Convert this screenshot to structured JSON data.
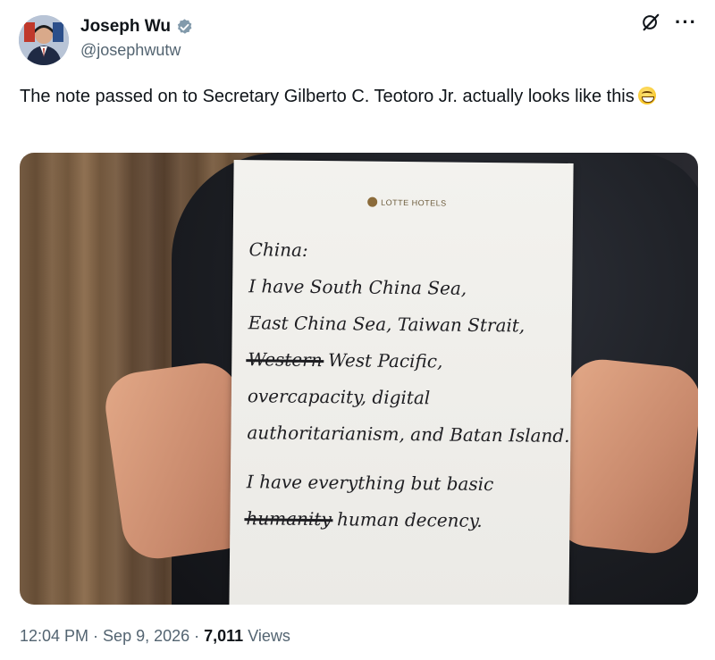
{
  "author": {
    "display_name": "Joseph Wu",
    "handle": "@josephwutw"
  },
  "tweet": {
    "text": "The note passed on to Secretary Gilberto C. Teotoro Jr. actually looks like this",
    "emoji_icon": "grinning-face-icon"
  },
  "media": {
    "brand": "LOTTE HOTELS",
    "note_lines": [
      {
        "before": "",
        "strike": "",
        "after": "China:"
      },
      {
        "before": "",
        "strike": "",
        "after": "I have South China Sea,"
      },
      {
        "before": "",
        "strike": "",
        "after": "East China Sea, Taiwan Strait,"
      },
      {
        "before": "",
        "strike": "Western",
        "after": " West Pacific,"
      },
      {
        "before": "",
        "strike": "",
        "after": "overcapacity, digital"
      },
      {
        "before": "",
        "strike": "",
        "after": "authoritarianism, and Batan Island."
      },
      {
        "before": "",
        "strike": "",
        "after": "I have everything but basic"
      },
      {
        "before": "",
        "strike": "humanity",
        "after": " human decency."
      }
    ]
  },
  "meta": {
    "time": "12:04 PM",
    "sep1": " · ",
    "date": "Sep 9, 2026",
    "sep2": " · ",
    "views_count": "7,011",
    "views_label": " Views"
  },
  "icons": {
    "verified": "verified-badge-icon",
    "grok": "grok-icon",
    "more": "more-options-icon"
  },
  "colors": {
    "text": "#0f1419",
    "secondary": "#536471",
    "verified": "#829aab"
  }
}
